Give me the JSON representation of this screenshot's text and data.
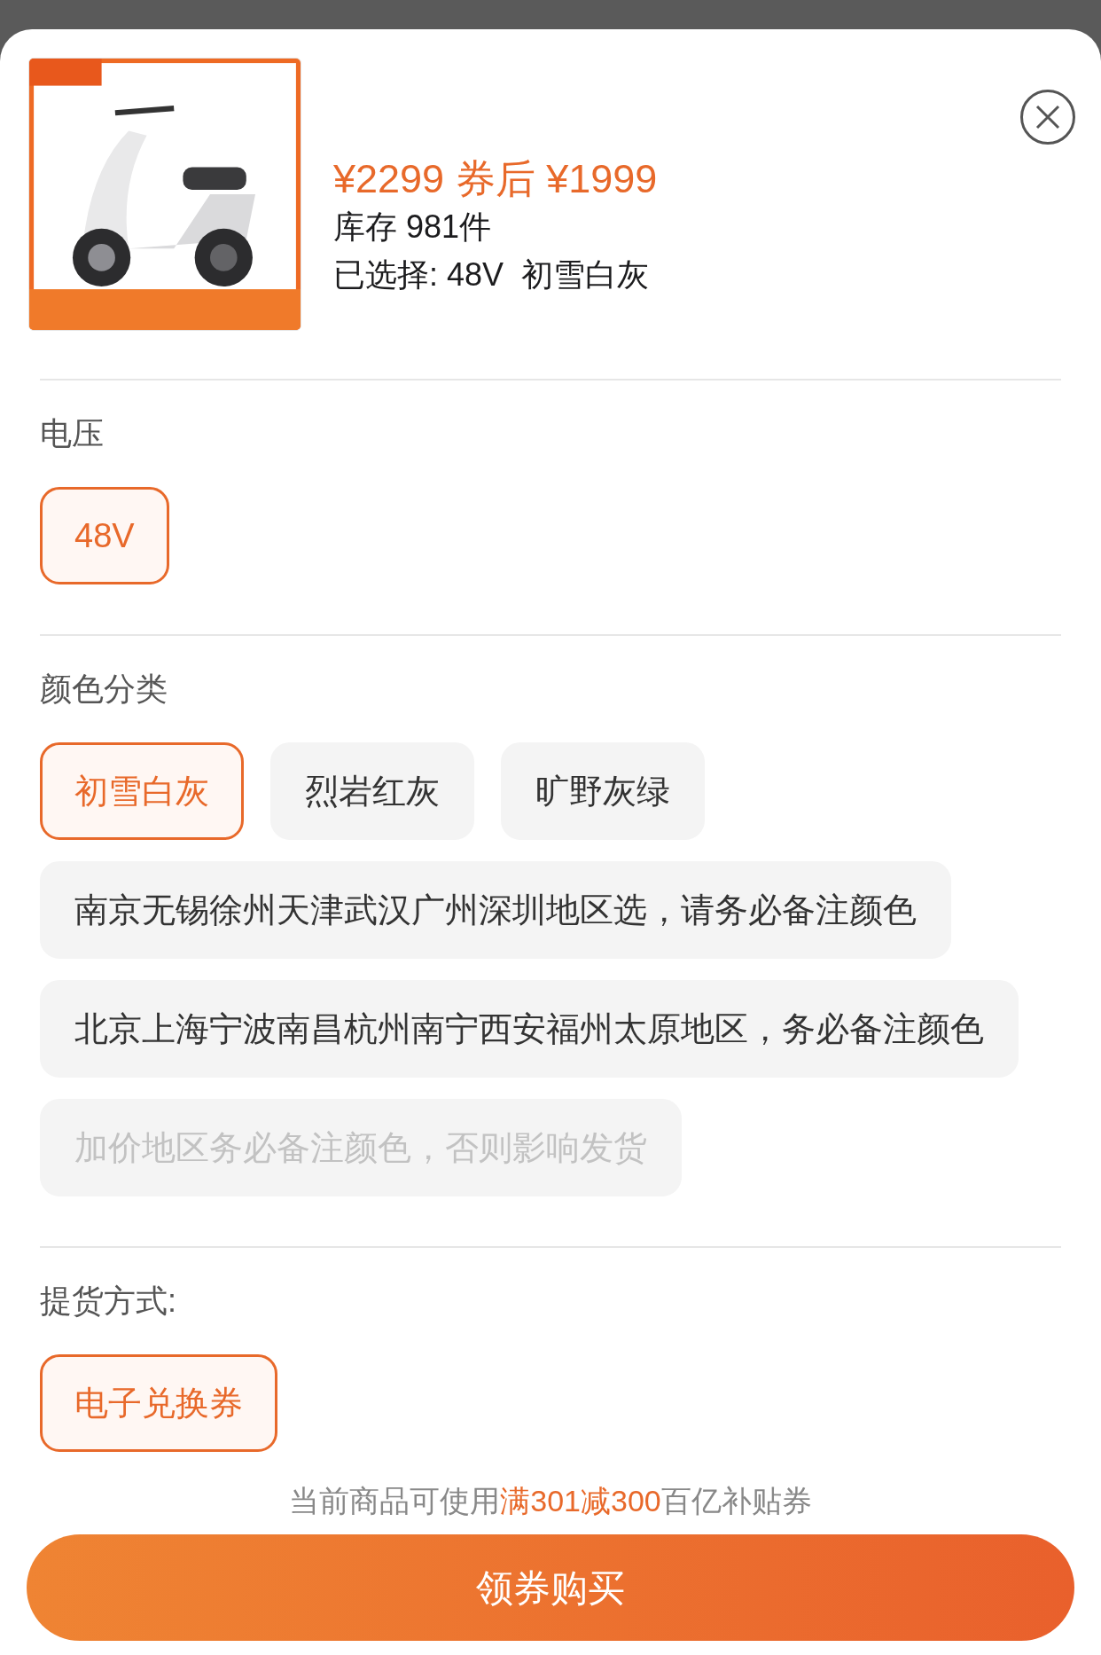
{
  "product": {
    "price": "¥2299 券后 ¥1999",
    "stock": "库存 981件",
    "selection": "已选择: 48V  初雪白灰"
  },
  "sections": [
    {
      "title": "电压",
      "options": [
        {
          "label": "48V",
          "selected": true,
          "disabled": false
        }
      ]
    },
    {
      "title": "颜色分类",
      "options": [
        {
          "label": "初雪白灰",
          "selected": true,
          "disabled": false
        },
        {
          "label": "烈岩红灰",
          "selected": false,
          "disabled": false
        },
        {
          "label": "旷野灰绿",
          "selected": false,
          "disabled": false
        },
        {
          "label": "南京无锡徐州天津武汉广州深圳地区选，请务必备注颜色",
          "selected": false,
          "disabled": false
        },
        {
          "label": "北京上海宁波南昌杭州南宁西安福州太原地区，务必备注颜色",
          "selected": false,
          "disabled": false
        },
        {
          "label": "加价地区务必备注颜色，否则影响发货",
          "selected": false,
          "disabled": true
        }
      ]
    },
    {
      "title": "提货方式:",
      "options": [
        {
          "label": "电子兑换券",
          "selected": true,
          "disabled": false
        }
      ]
    }
  ],
  "coupon_note": {
    "before": "当前商品可使用",
    "highlight": "满301减300",
    "after": "百亿补贴券"
  },
  "buy_button": "领券购买"
}
